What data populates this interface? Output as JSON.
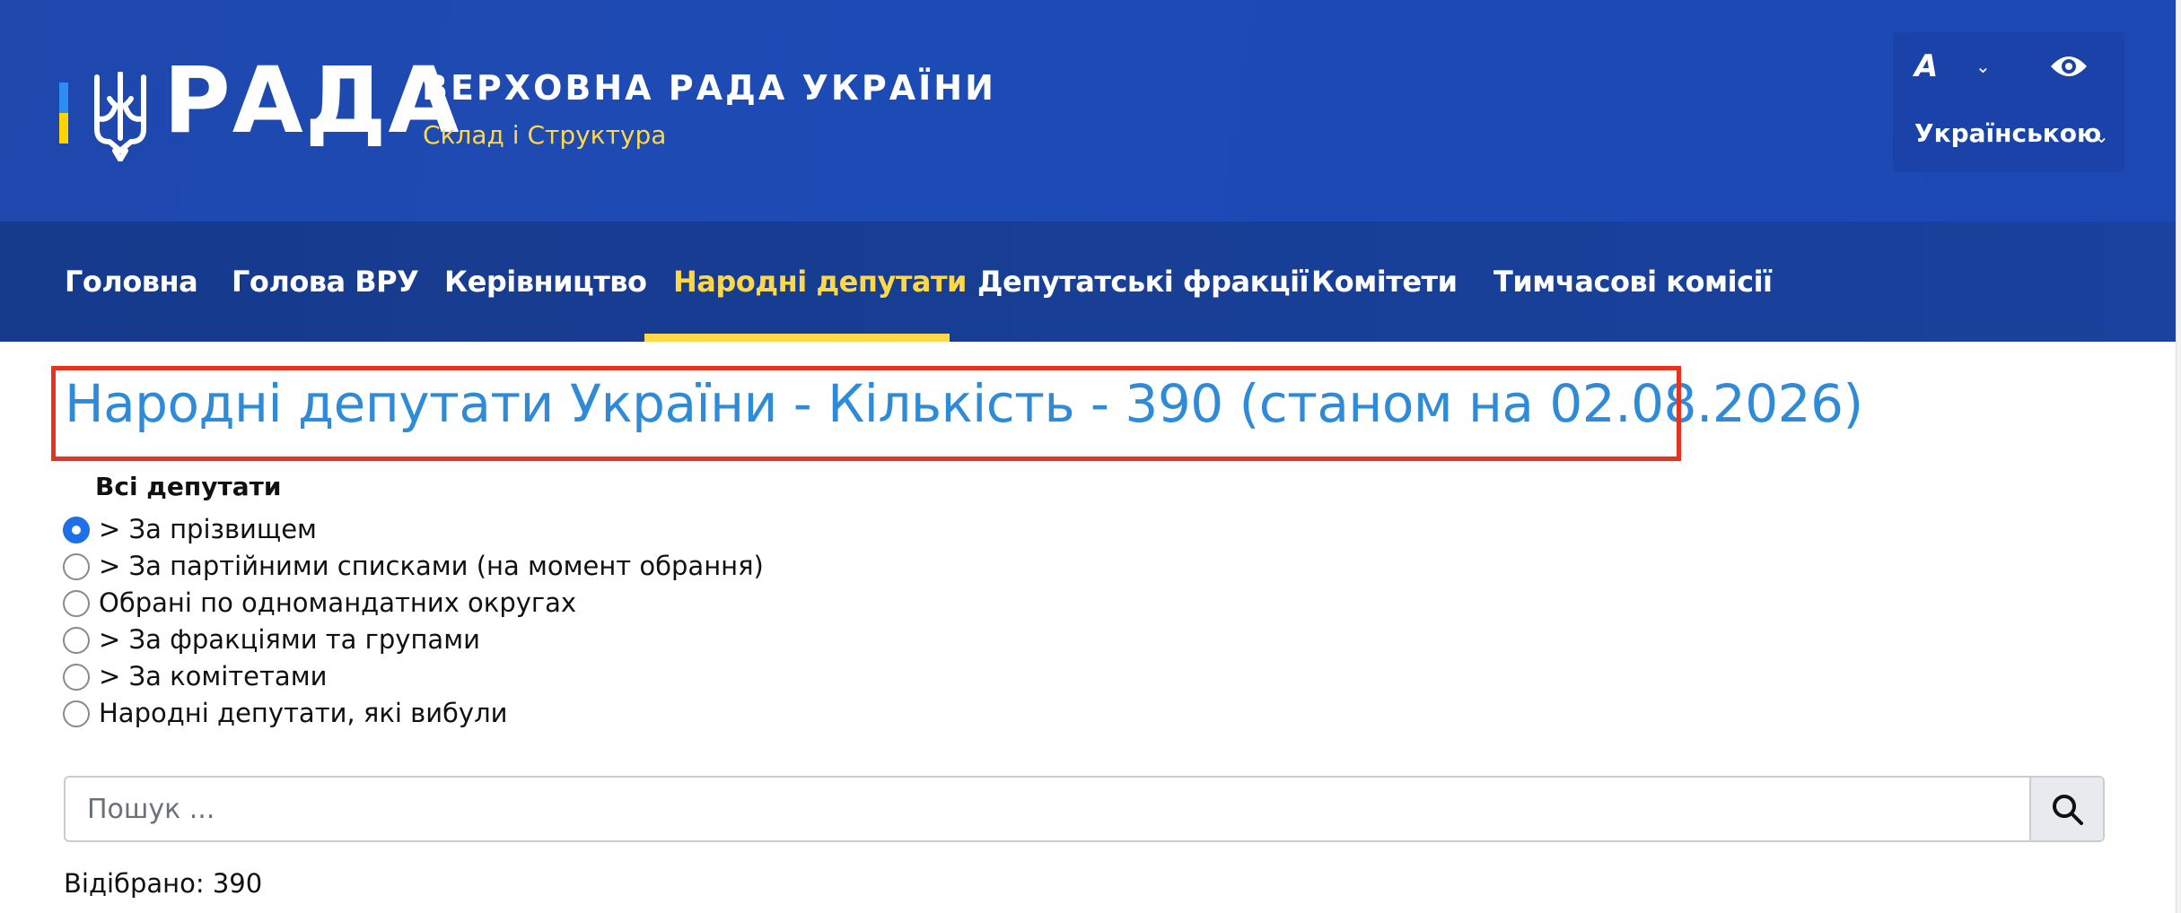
{
  "header": {
    "logo_text": "РАДА",
    "site_title": "ВЕРХОВНА РАДА УКРАЇНИ",
    "site_subtitle": "Склад і Структура",
    "font_control_label": "A",
    "language_label": "Українською",
    "colors": {
      "header_blue": "#1d4bb6",
      "accent_yellow": "#ffd84a",
      "flag_blue": "#2e8cf5",
      "flag_yellow": "#ffd400"
    },
    "icons": [
      "trident-icon",
      "font-size-icon",
      "eye-icon",
      "chevron-down-icon"
    ]
  },
  "nav": {
    "items": [
      {
        "label": "Головна",
        "active": false
      },
      {
        "label": "Голова ВРУ",
        "active": false
      },
      {
        "label": "Керівництво",
        "active": false
      },
      {
        "label": "Народні депутати",
        "active": true
      },
      {
        "label": "Депутатські фракції",
        "active": false
      },
      {
        "label": "Комітети",
        "active": false
      },
      {
        "label": "Тимчасові комісії",
        "active": false
      }
    ]
  },
  "main": {
    "title": "Народні депутати України - Кількість - 390 (станом на 02.08.2026)",
    "filter_group_label": "Всі депутати",
    "filters": [
      {
        "label": "> За прізвищем",
        "checked": true
      },
      {
        "label": "> За партійними списками (на момент обрання)",
        "checked": false
      },
      {
        "label": "Обрані по одномандатних округах",
        "checked": false
      },
      {
        "label": "> За фракціями та групами",
        "checked": false
      },
      {
        "label": "> За комітетами",
        "checked": false
      },
      {
        "label": "Народні депутати, які вибули",
        "checked": false
      }
    ],
    "search": {
      "placeholder": "Пошук ...",
      "value": ""
    },
    "result_count": "Відібрано: 390",
    "colors": {
      "title_blue": "#2f8bd8",
      "highlight_red": "#e8311f",
      "radio_blue": "#1f6fe6"
    }
  }
}
